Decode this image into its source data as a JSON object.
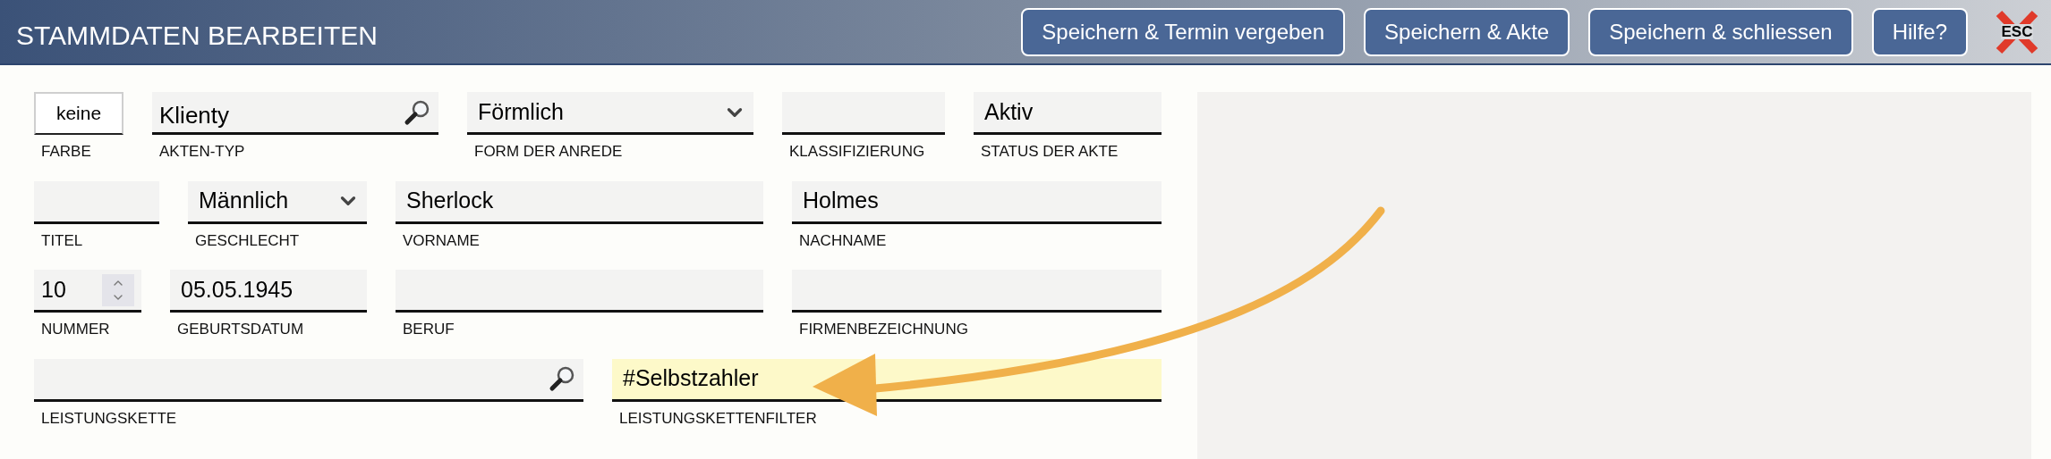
{
  "header": {
    "title": "STAMMDATEN BEARBEITEN",
    "buttons": [
      "Speichern & Termin vergeben",
      "Speichern & Akte",
      "Speichern & schliessen",
      "Hilfe?"
    ],
    "close": {
      "label": "ESC"
    }
  },
  "form": {
    "rows": [
      [
        {
          "kind": "color",
          "label": "FARBE",
          "value": "keine"
        },
        {
          "kind": "search",
          "label": "AKTEN-TYP",
          "value": "Klienty"
        },
        {
          "kind": "select",
          "label": "FORM DER ANREDE",
          "value": "Förmlich"
        },
        {
          "kind": "text",
          "label": "KLASSIFIZIERUNG"
        },
        {
          "kind": "text",
          "label": "STATUS DER AKTE",
          "value": "Aktiv"
        }
      ],
      [
        {
          "kind": "text",
          "label": "TITEL"
        },
        {
          "kind": "select",
          "label": "GESCHLECHT",
          "value": "Männlich"
        },
        {
          "kind": "text",
          "label": "VORNAME",
          "value": "Sherlock"
        },
        {
          "kind": "text",
          "label": "NACHNAME",
          "value": "Holmes"
        }
      ],
      [
        {
          "kind": "spinner",
          "label": "NUMMER",
          "value": "10"
        },
        {
          "kind": "text",
          "label": "GEBURTSDATUM",
          "value": "05.05.1945"
        },
        {
          "kind": "text",
          "label": "BERUF"
        },
        {
          "kind": "text",
          "label": "FIRMENBEZEICHNUNG"
        }
      ],
      [
        {
          "kind": "search",
          "label": "LEISTUNGSKETTE"
        },
        {
          "kind": "text",
          "label": "LEISTUNGSKETTENFILTER",
          "value": "#Selbstzahler",
          "highlighted": true
        }
      ]
    ]
  }
}
